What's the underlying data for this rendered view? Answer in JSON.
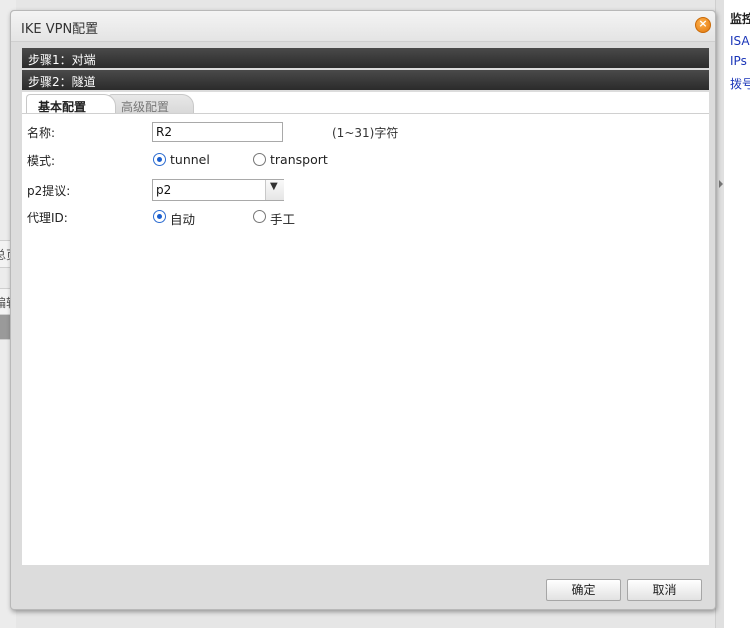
{
  "background": {
    "left_tabs": [
      "总页",
      "编辑",
      ""
    ],
    "right_panel": {
      "title": "监控",
      "links": [
        "ISA",
        "IPs",
        "拨号"
      ]
    }
  },
  "dialog": {
    "title": "IKE VPN配置",
    "close_icon": "close-icon",
    "steps": [
      "步骤1：对端",
      "步骤2：隧道"
    ],
    "tabs": [
      {
        "label": "基本配置",
        "active": true
      },
      {
        "label": "高级配置",
        "active": false
      }
    ],
    "form": {
      "name": {
        "label": "名称:",
        "value": "R2",
        "hint": "(1~31)字符"
      },
      "mode": {
        "label": "模式:",
        "options": [
          "tunnel",
          "transport"
        ],
        "selected": "tunnel"
      },
      "p2_proposal": {
        "label": "p2提议:",
        "value": "p2"
      },
      "proxy_id": {
        "label": "代理ID:",
        "options": [
          "自动",
          "手工"
        ],
        "selected": "自动"
      }
    },
    "buttons": {
      "ok": "确定",
      "cancel": "取消"
    }
  },
  "colors": {
    "accent": "#1a5fcf",
    "step_bar": "#2b2b2b",
    "close": "#e0760c",
    "link": "#1a35b8"
  }
}
